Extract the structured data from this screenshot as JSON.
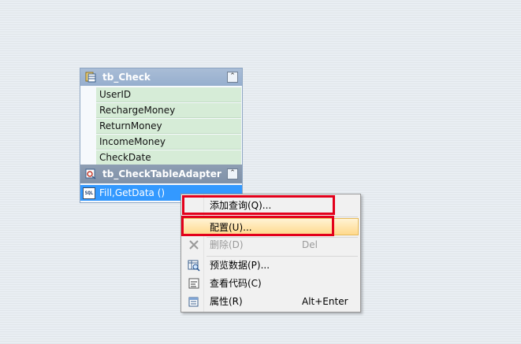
{
  "datatable": {
    "title": "tb_Check",
    "columns": [
      "UserID",
      "RechargeMoney",
      "ReturnMoney",
      "IncomeMoney",
      "CheckDate"
    ]
  },
  "adapter": {
    "title": "tb_CheckTableAdapter",
    "query": "Fill,GetData ()",
    "sql_badge": "SQL"
  },
  "context_menu": {
    "items": [
      {
        "label": "添加查询(Q)...",
        "shortcut": "",
        "icon": "",
        "enabled": true
      },
      {
        "label": "配置(U)...",
        "shortcut": "",
        "icon": "",
        "enabled": true,
        "highlighted": true
      },
      {
        "label": "删除(D)",
        "shortcut": "Del",
        "icon": "delete-x-icon",
        "enabled": false
      },
      {
        "label": "预览数据(P)...",
        "shortcut": "",
        "icon": "preview-data-icon",
        "enabled": true
      },
      {
        "label": "查看代码(C)",
        "shortcut": "",
        "icon": "view-code-icon",
        "enabled": true
      },
      {
        "label": "属性(R)",
        "shortcut": "Alt+Enter",
        "icon": "properties-icon",
        "enabled": true
      }
    ]
  },
  "colors": {
    "annotation_red": "#e3001b",
    "selection_blue": "#3399ff",
    "column_green": "#d6ecd7"
  }
}
